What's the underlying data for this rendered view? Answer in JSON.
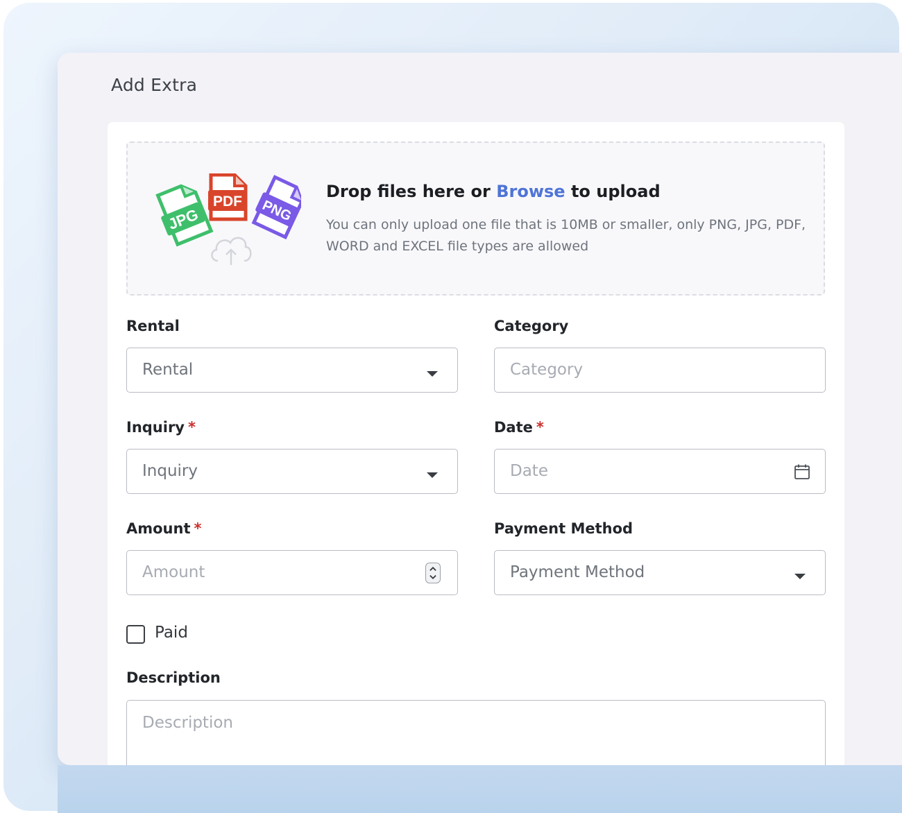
{
  "page": {
    "title": "Add Extra"
  },
  "upload": {
    "title_pre": "Drop files here or ",
    "browse_label": "Browse",
    "title_post": " to upload",
    "hint": "You can only upload one file that is 10MB or smaller, only PNG, JPG, PDF, WORD and EXCEL file types are allowed",
    "file_badges": [
      "JPG",
      "PDF",
      "PNG"
    ],
    "icons": [
      "jpg-file-icon",
      "pdf-file-icon",
      "png-file-icon",
      "cloud-upload-icon"
    ],
    "colors": {
      "jpg": "#3fbf6b",
      "pdf": "#d9452b",
      "png": "#7a5ae6",
      "browse": "#4f74d6"
    }
  },
  "form": {
    "rental": {
      "label": "Rental",
      "value": "Rental"
    },
    "category": {
      "label": "Category",
      "placeholder": "Category"
    },
    "inquiry": {
      "label": "Inquiry",
      "required_mark": "*",
      "value": "Inquiry"
    },
    "date": {
      "label": "Date",
      "required_mark": "*",
      "placeholder": "Date"
    },
    "amount": {
      "label": "Amount",
      "required_mark": "*",
      "placeholder": "Amount"
    },
    "payment_method": {
      "label": "Payment Method",
      "value": "Payment Method"
    },
    "paid": {
      "label": "Paid",
      "checked": false
    },
    "description": {
      "label": "Description",
      "placeholder": "Description"
    }
  }
}
